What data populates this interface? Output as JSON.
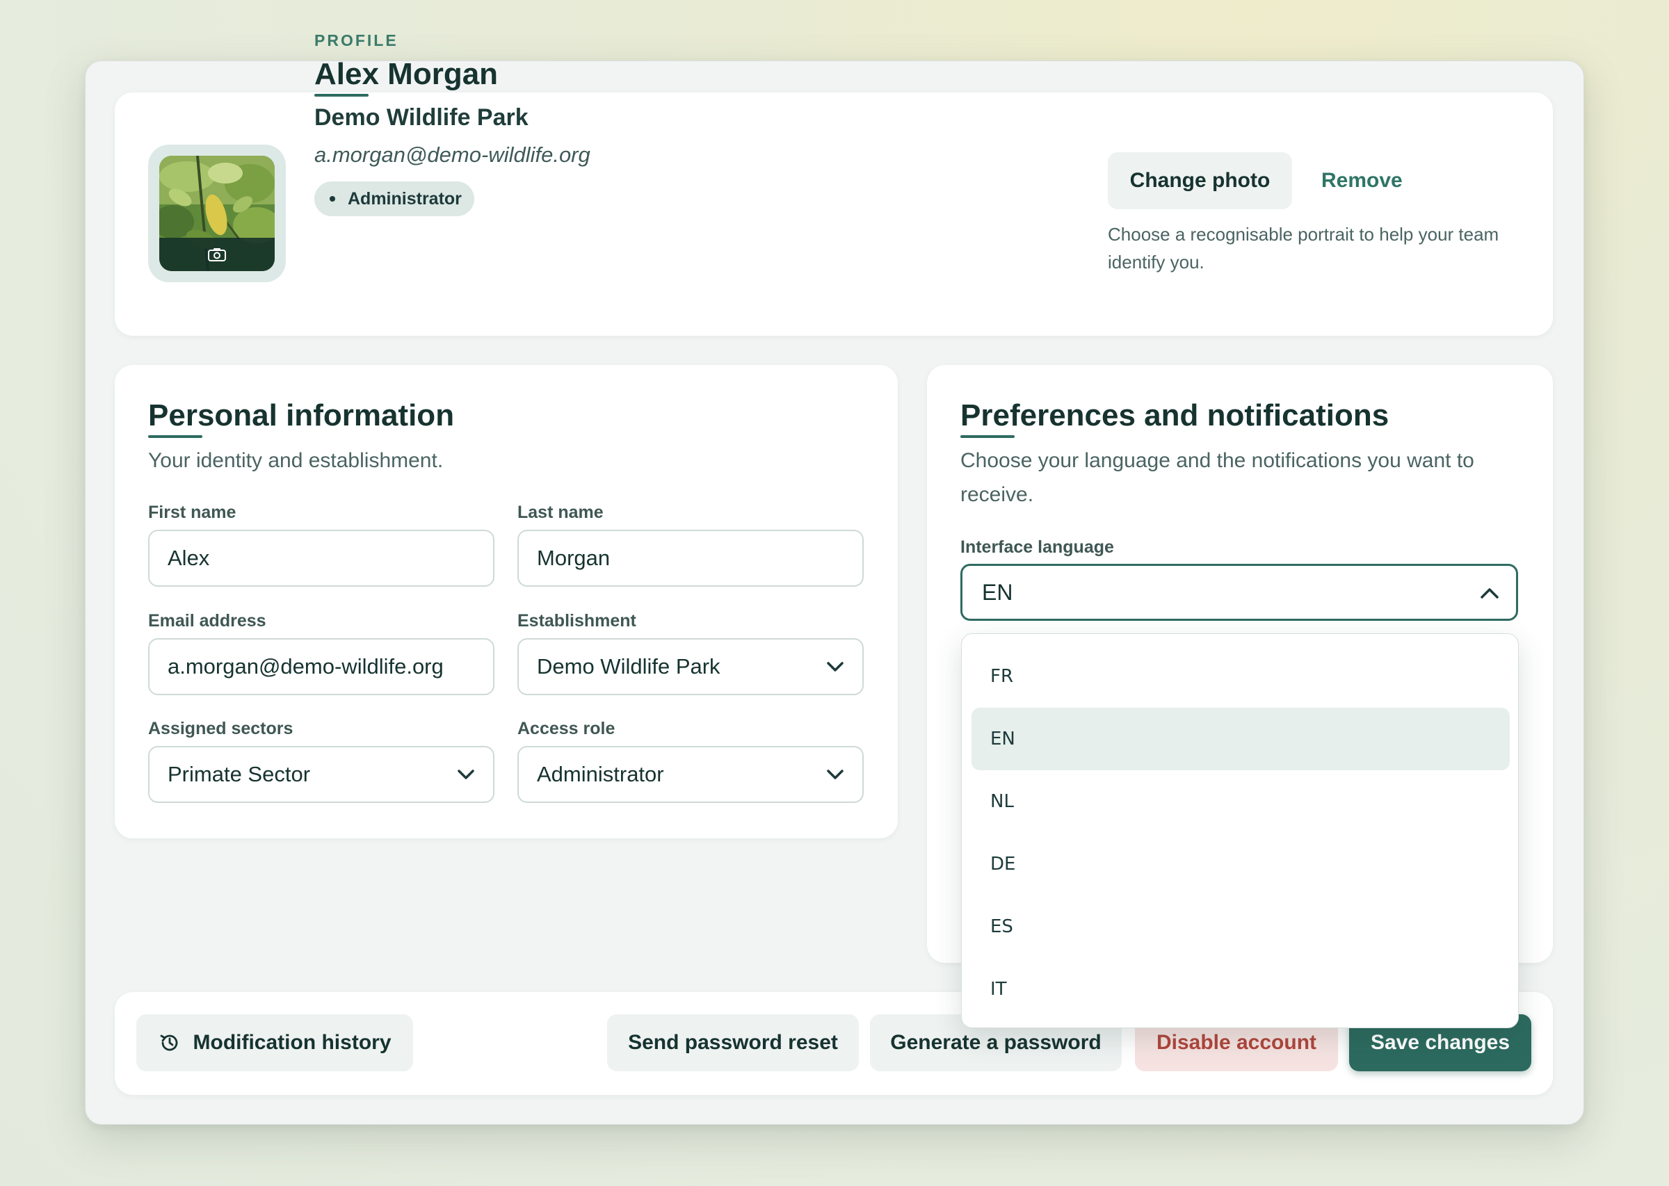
{
  "profile": {
    "eyebrow": "PROFILE",
    "name": "Alex Morgan",
    "organization": "Demo Wildlife Park",
    "email": "a.morgan@demo-wildlife.org",
    "role_badge": "Administrator",
    "avatar_icon": "camera-icon",
    "change_photo": "Change photo",
    "remove": "Remove",
    "photo_hint": "Choose a recognisable portrait to help your team identify you."
  },
  "personal": {
    "title": "Personal information",
    "subtitle": "Your identity and establishment.",
    "first_name": {
      "label": "First name",
      "value": "Alex"
    },
    "last_name": {
      "label": "Last name",
      "value": "Morgan"
    },
    "email": {
      "label": "Email address",
      "value": "a.morgan@demo-wildlife.org"
    },
    "establishment": {
      "label": "Establishment",
      "value": "Demo Wildlife Park"
    },
    "sectors": {
      "label": "Assigned sectors",
      "value": "Primate Sector"
    },
    "role": {
      "label": "Access role",
      "value": "Administrator"
    }
  },
  "preferences": {
    "title": "Preferences and notifications",
    "subtitle": "Choose your language and the notifications you want to receive.",
    "language": {
      "label": "Interface language",
      "value": "EN",
      "options": [
        "FR",
        "EN",
        "NL",
        "DE",
        "ES",
        "IT"
      ],
      "selected": "EN"
    }
  },
  "footer": {
    "history": "Modification history",
    "history_icon": "history-icon",
    "password_reset": "Send password reset",
    "generate_password": "Generate a password",
    "disable_account": "Disable account",
    "save": "Save changes"
  },
  "colors": {
    "accent": "#2c6a5f",
    "danger": "#b0463c",
    "danger_bg": "#f6e3e1"
  }
}
